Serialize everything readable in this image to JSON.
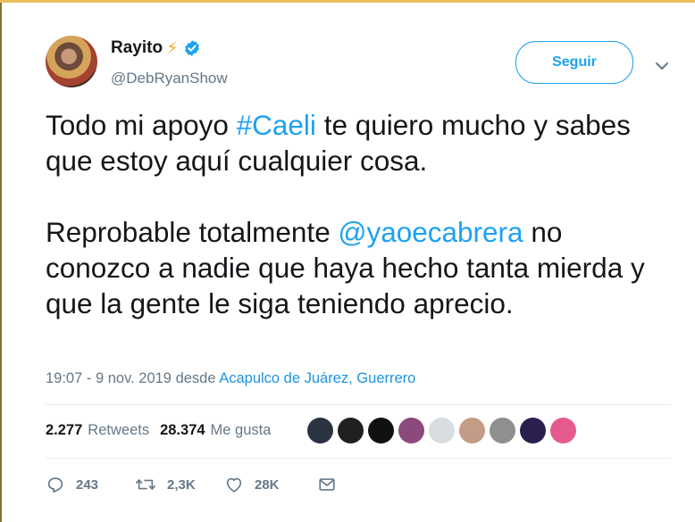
{
  "user": {
    "name": "Rayito",
    "name_emoji": "⚡",
    "handle": "@DebRyanShow",
    "verified": true
  },
  "follow_button": {
    "label": "Seguir"
  },
  "tweet": {
    "paragraph1": {
      "part1": "Todo mi apoyo ",
      "hashtag": "#Caeli",
      "part2": " te quiero mucho y sabes que estoy aquí cualquier cosa."
    },
    "paragraph2": {
      "part1": "Reprobable totalmente ",
      "mention": "@yaoecabrera",
      "part2": " no conozco a nadie que haya hecho tanta mierda y que la gente le siga teniendo aprecio."
    }
  },
  "meta": {
    "time": "19:07 - 9 nov. 2019",
    "from": "desde",
    "location": "Acapulco de Juárez, Guerrero"
  },
  "stats": {
    "retweets_count": "2.277",
    "retweets_label": "Retweets",
    "likes_count": "28.374",
    "likes_label": "Me gusta"
  },
  "likers_colors": [
    "#2b3340",
    "#202020",
    "#111111",
    "#8a4a7c",
    "#d8dde2",
    "#c49c86",
    "#8f8f8f",
    "#2a1f4f",
    "#e45a8c"
  ],
  "actions": {
    "replies": "243",
    "retweets": "2,3K",
    "likes": "28K"
  },
  "colors": {
    "accent": "#1da1f2",
    "secondary": "#657786"
  }
}
